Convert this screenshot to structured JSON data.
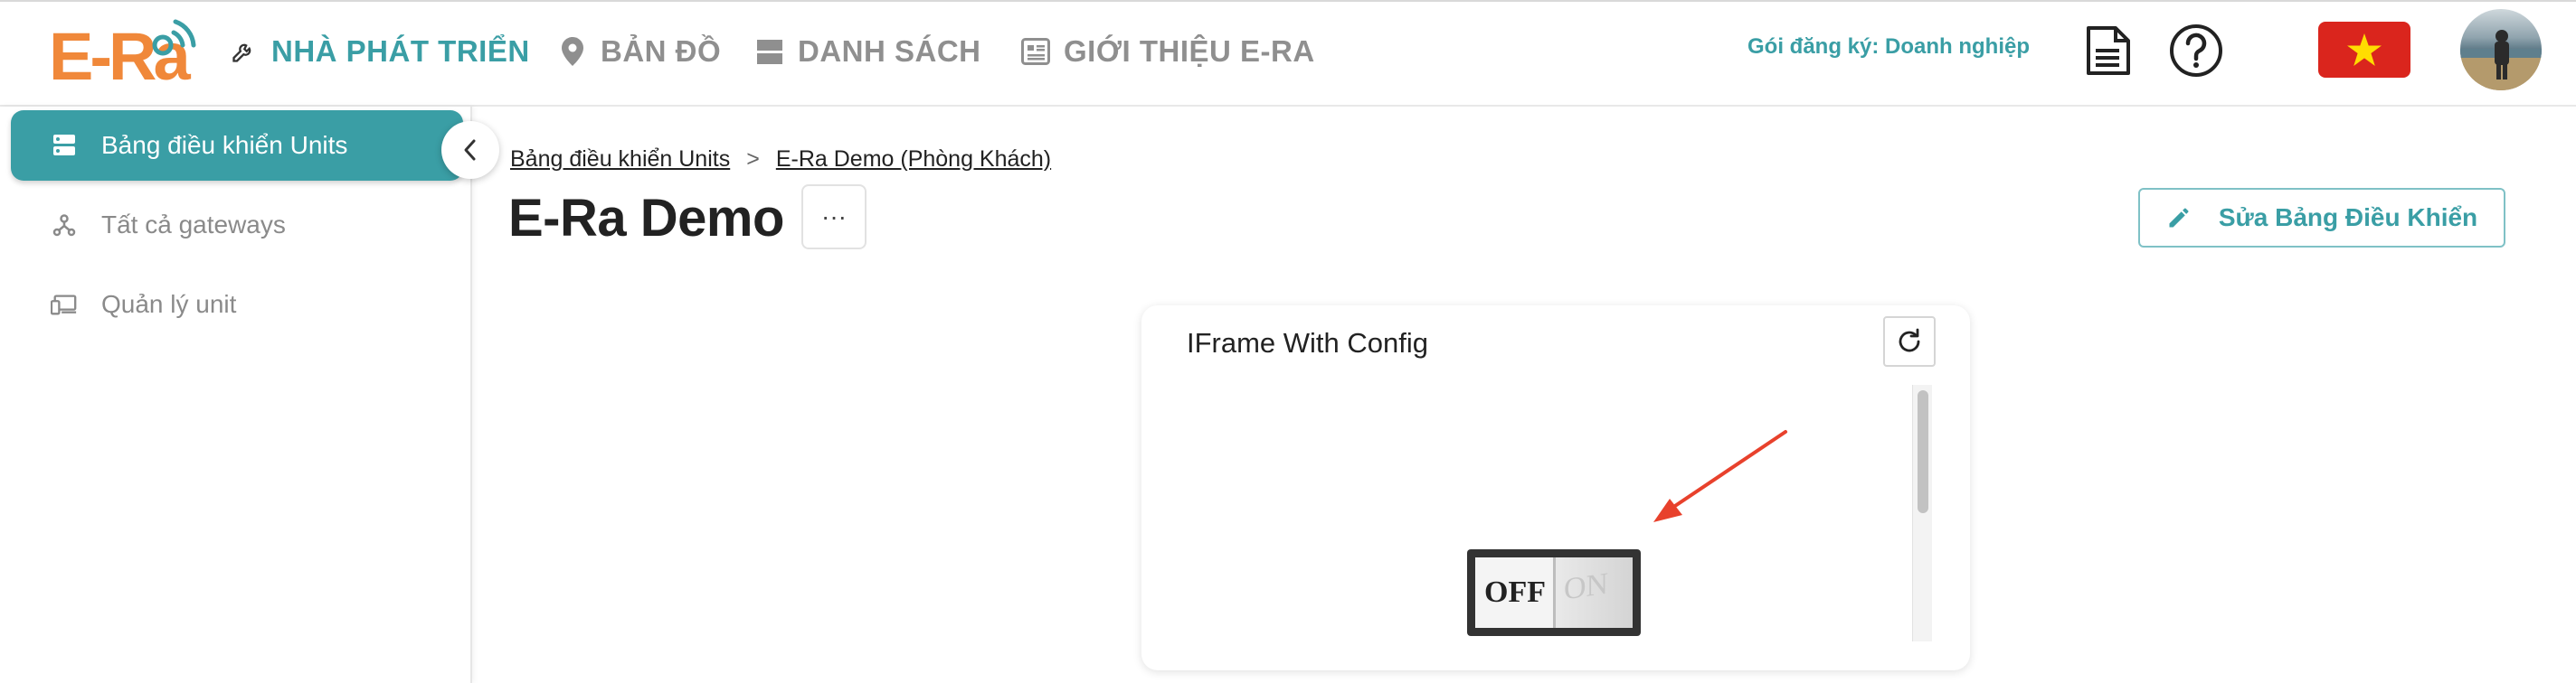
{
  "header": {
    "logo_text": "E-Ra",
    "nav": [
      {
        "label": "NHÀ PHÁT TRIỂN",
        "icon": "wrench-icon",
        "active": true
      },
      {
        "label": "BẢN ĐỒ",
        "icon": "map-pin-icon",
        "active": false
      },
      {
        "label": "DANH SÁCH",
        "icon": "list-icon",
        "active": false
      },
      {
        "label": "GIỚI THIỆU E-RA",
        "icon": "newspaper-icon",
        "active": false
      }
    ],
    "plan_label": "Gói đăng ký: Doanh nghiệp",
    "icons": [
      "document-icon",
      "help-icon",
      "vietnam-flag-icon",
      "user-avatar"
    ]
  },
  "sidebar": {
    "items": [
      {
        "label": "Bảng điều khiển Units",
        "icon": "dashboard-icon",
        "active": true
      },
      {
        "label": "Tất cả gateways",
        "icon": "gateway-icon",
        "active": false
      },
      {
        "label": "Quản lý unit",
        "icon": "devices-icon",
        "active": false
      }
    ]
  },
  "breadcrumb": {
    "items": [
      "Bảng điều khiển Units",
      "E-Ra Demo (Phòng Khách)"
    ],
    "separator": ">"
  },
  "page": {
    "title": "E-Ra Demo",
    "more_label": "···",
    "edit_button_label": "Sửa Bảng Điều Khiển"
  },
  "widget": {
    "title": "IFrame With Config",
    "switch": {
      "off_label": "OFF",
      "on_label": "ON",
      "state": "off"
    }
  },
  "colors": {
    "accent": "#3a9ea5",
    "logo": "#f0883a",
    "flag_red": "#da251d",
    "flag_star": "#ffdd00",
    "arrow": "#e8412c"
  }
}
